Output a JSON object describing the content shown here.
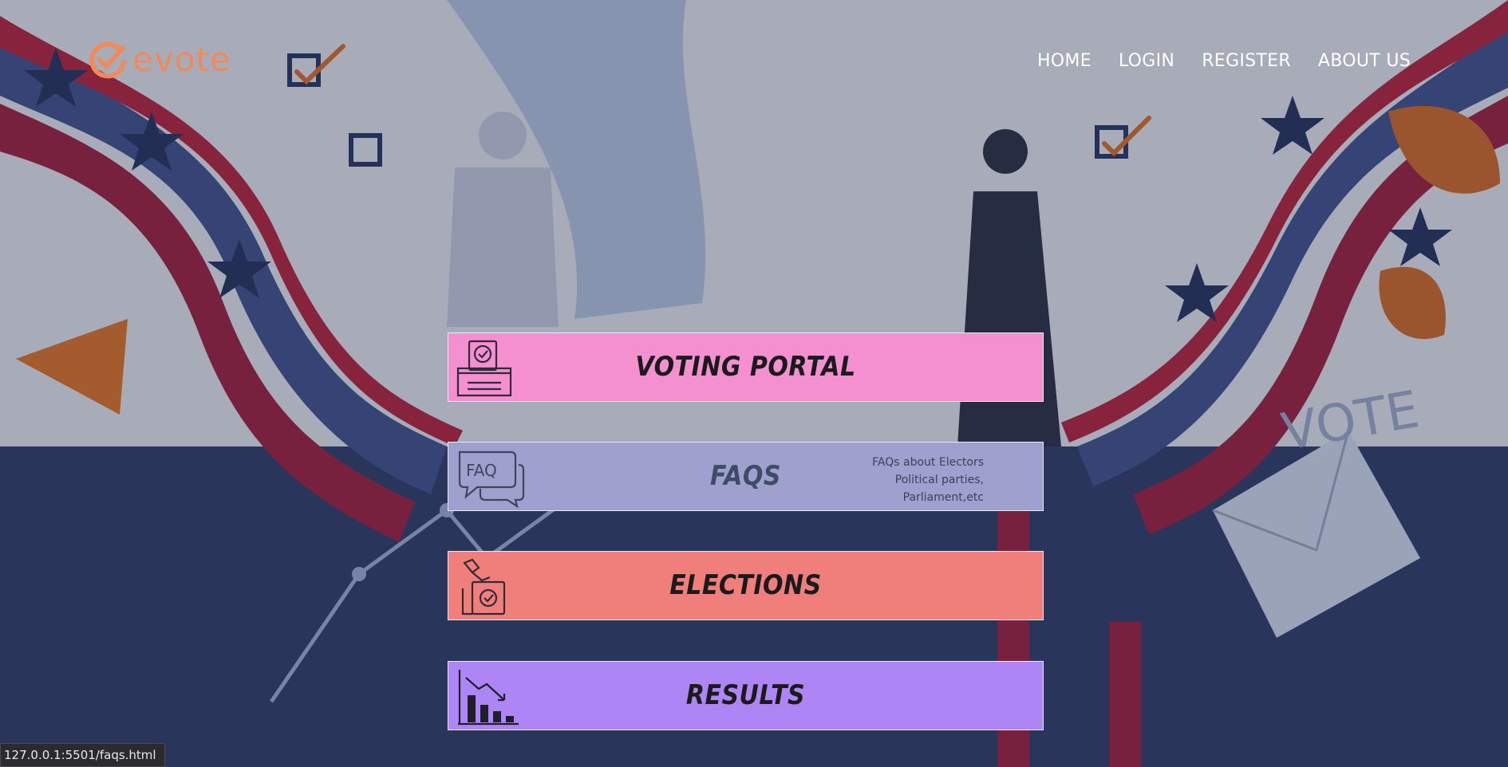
{
  "header": {
    "logo_text": "evote",
    "nav": [
      "HOME",
      "LOGIN",
      "REGISTER",
      "ABOUT US"
    ]
  },
  "cards": {
    "voting_portal": {
      "title": "VOTING PORTAL",
      "icon": "ballot-box-icon"
    },
    "faqs": {
      "title": "FAQS",
      "icon": "faq-speech-bubbles-icon",
      "description": [
        "FAQs about Electors",
        "Political parties,",
        "Parliament,etc"
      ]
    },
    "elections": {
      "title": "ELECTIONS",
      "icon": "hand-voting-icon"
    },
    "results": {
      "title": "RESULTS",
      "icon": "bar-chart-decline-icon"
    }
  },
  "background": {
    "sign_text": "VOTE"
  },
  "status_bar": {
    "url": "127.0.0.1:5501/faqs.html"
  },
  "colors": {
    "logo": "#f08a5d",
    "voting_portal": "#f48fd0",
    "faqs": "#9fa0cd",
    "elections": "#f07e7a",
    "results": "#ad85f5"
  }
}
